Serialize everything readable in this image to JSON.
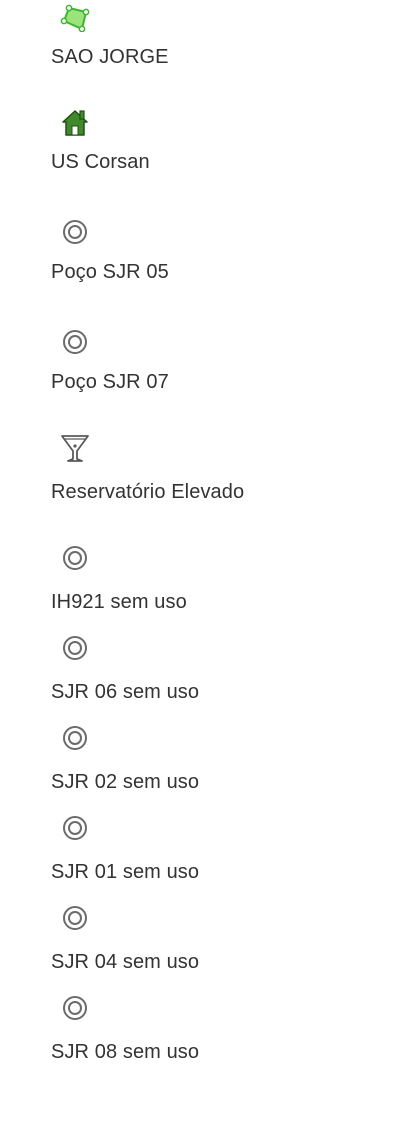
{
  "layer_list": {
    "header_icon": "polygon-area-icon",
    "items": [
      {
        "label": "SAO JORGE",
        "icon": "house-icon"
      },
      {
        "label": "US Corsan",
        "icon": "target-circle-icon"
      },
      {
        "label": "Poço SJR 05",
        "icon": "target-circle-icon"
      },
      {
        "label": "Poço SJR 07",
        "icon": "funnel-tank-icon"
      },
      {
        "label": "Reservatório Elevado",
        "icon": "target-circle-icon"
      },
      {
        "label": "IH921 sem uso",
        "icon": "target-circle-icon"
      },
      {
        "label": "SJR 06 sem uso",
        "icon": "target-circle-icon"
      },
      {
        "label": "SJR 02 sem uso",
        "icon": "target-circle-icon"
      },
      {
        "label": "SJR 01 sem uso",
        "icon": "target-circle-icon"
      },
      {
        "label": "SJR 04 sem uso",
        "icon": "target-circle-icon"
      },
      {
        "label": "SJR 08 sem uso"
      }
    ],
    "colors": {
      "polygon_fill": "#9be37a",
      "polygon_stroke": "#38b82c",
      "house_green": "#3f8a2a",
      "house_dark": "#1f5016",
      "target_gray": "#6b6b6b",
      "text": "#333333"
    }
  }
}
